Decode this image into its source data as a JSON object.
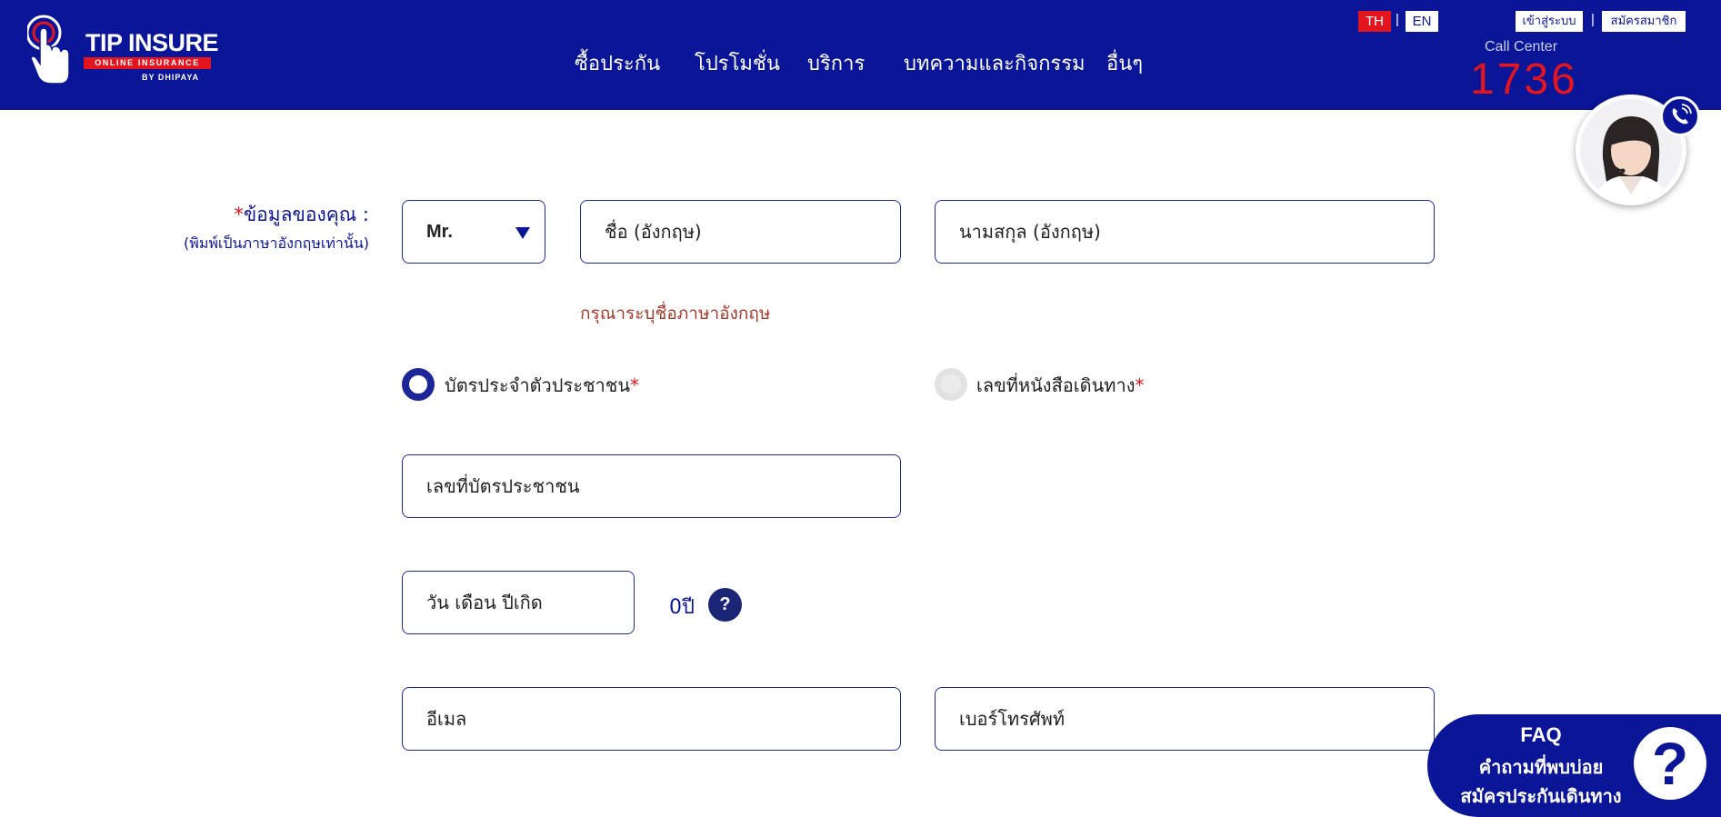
{
  "header": {
    "logo": {
      "title": "TIP INSURE",
      "banner": "ONLINE INSURANCE",
      "by": "BY DHIPAYA"
    },
    "nav": [
      {
        "label": "ซื้อประกัน"
      },
      {
        "label": "โปรโมชั่น"
      },
      {
        "label": "บริการ"
      },
      {
        "label": "บทความและกิจกรรม"
      },
      {
        "label": "อื่นๆ"
      }
    ],
    "lang": {
      "th": "TH",
      "en": "EN",
      "separator": "|"
    },
    "login_label": "เข้าสู่ระบบ",
    "register_label": "สมัครสมาชิก",
    "call_center": {
      "label": "Call Center",
      "number": "1736"
    }
  },
  "form": {
    "personal_label": "ข้อมูลของคุณ :",
    "personal_required_mark": "*",
    "personal_sublabel": "(พิมพ์เป็นภาษาอังกฤษเท่านั้น)",
    "title_select": {
      "value": "Mr."
    },
    "first_name": {
      "placeholder": "ชื่อ (อังกฤษ)"
    },
    "last_name": {
      "placeholder": "นามสกุล (อังกฤษ)"
    },
    "name_error": "กรุณาระบุชื่อภาษาอังกฤษ",
    "id_type": {
      "options": [
        {
          "label": "บัตรประจำตัวประชาชน",
          "required_mark": "*",
          "selected": true
        },
        {
          "label": "เลขที่หนังสือเดินทาง",
          "required_mark": "*",
          "selected": false
        }
      ]
    },
    "id_number": {
      "placeholder": "เลขที่บัตรประชาชน"
    },
    "birthdate": {
      "placeholder": "วัน เดือน ปีเกิด"
    },
    "age_text": "0ปี",
    "help_symbol": "?",
    "email": {
      "placeholder": "อีเมล"
    },
    "phone": {
      "placeholder": "เบอร์โทรศัพท์"
    }
  },
  "faq": {
    "title": "FAQ",
    "line2": "คำถามที่พบบ่อย",
    "line3": "สมัครประกันเดินทาง",
    "icon_symbol": "?"
  },
  "colors": {
    "brand_blue": "#0a1597",
    "brand_red": "#e3151f",
    "error_text": "#a33a2e"
  }
}
